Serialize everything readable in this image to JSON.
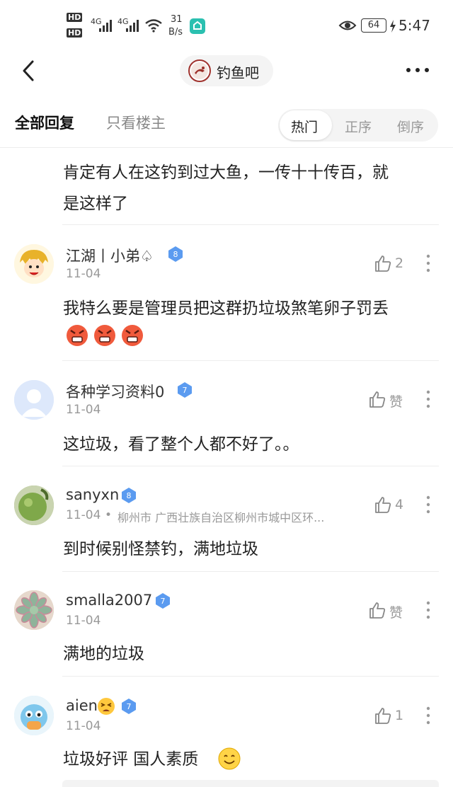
{
  "status_bar": {
    "hd1": "HD",
    "hd2": "HD",
    "net1": "4G",
    "net2": "4G",
    "speed_value": "31",
    "speed_unit": "B/s",
    "battery": "64",
    "time": "5:47"
  },
  "header": {
    "forum_name": "钓鱼吧"
  },
  "tabs": {
    "all_replies": "全部回复",
    "only_op": "只看楼主",
    "sort": [
      "热门",
      "正序",
      "倒序"
    ]
  },
  "top_reply_text": [
    "肯定有人在这钓到过大鱼，一传十十传百，就",
    "是这样了"
  ],
  "replies": [
    {
      "username": "江湖丨小弟♤",
      "level": "8",
      "date": "11-04",
      "location": "",
      "likes": "2",
      "text": "我特么要是管理员把这群扔垃圾煞笔卵子罚丢",
      "emojis": [
        "angry-emoji",
        "angry-emoji",
        "angry-emoji"
      ]
    },
    {
      "username": "各种学习资料0",
      "level": "7",
      "date": "11-04",
      "location": "",
      "likes": "赞",
      "text": "这垃圾，看了整个人都不好了。。"
    },
    {
      "username": "sanyxn",
      "level": "8",
      "date": "11-04",
      "location": "柳州市 广西壮族自治区柳州市城中区环...",
      "likes": "4",
      "text": "到时候别怪禁钓，满地垃圾"
    },
    {
      "username": "smalla2007",
      "level": "7",
      "date": "11-04",
      "location": "",
      "likes": "赞",
      "text": "满地的垃圾"
    },
    {
      "username": "aien",
      "level": "7",
      "date": "11-04",
      "location": "",
      "likes": "1",
      "text": "垃圾好评 国人素质"
    }
  ],
  "colors": {
    "badge": "#5b9bf0",
    "accent_text": "#222222",
    "muted": "#999999"
  }
}
